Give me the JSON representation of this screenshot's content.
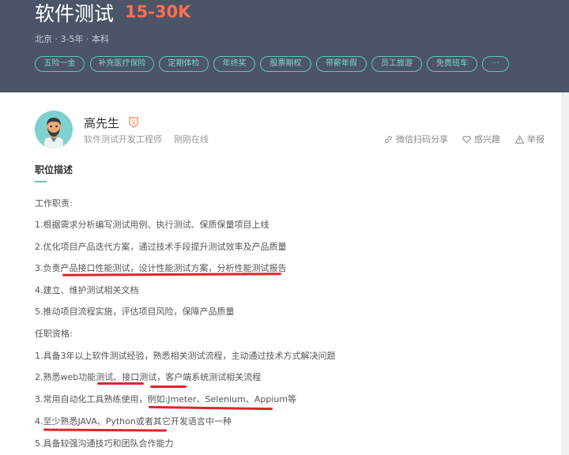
{
  "job": {
    "title": "软件测试",
    "salary": "15-30K",
    "meta": "北京 · 3-5年 · 本科"
  },
  "tags": [
    "五险一金",
    "补充医疗保险",
    "定期体检",
    "年终奖",
    "股票期权",
    "带薪年假",
    "员工旅游",
    "免费班车",
    "···"
  ],
  "recruiter": {
    "name": "高先生",
    "badge": "V",
    "role": "软件测试开发工程师",
    "status": "刚刚在线"
  },
  "actions": {
    "share": "微信扫码分享",
    "interest": "感兴趣",
    "report": "举报"
  },
  "description": {
    "section_title": "职位描述",
    "lines": [
      "工作职责:",
      "1.根据需求分析编写测试用例、执行测试、保质保量项目上线",
      "2.优化项目产品迭代方案，通过技术手段提升测试效率及产品质量",
      "3.负责产品接口性能测试，设计性能测试方案，分析性能测试报告",
      "4.建立、维护测试相关文档",
      "5.推动项目流程实施，评估项目风险，保障产品质量",
      "任职资格:",
      "1.具备3年以上软件测试经验，熟悉相关测试流程，主动通过技术方式解决问题",
      "2.熟悉web功能测试、接口测试，客户端系统测试相关流程",
      "3.常用自动化工具熟练使用，例如:Jmeter、Selenium、Appium等",
      "4.至少熟悉JAVA、Python或者其它开发语言中一种",
      "5.具备较强沟通技巧和团队合作能力"
    ]
  },
  "colors": {
    "header_bg": "#4b5567",
    "salary": "#ff6f4e",
    "accent": "#5fc6b6",
    "highlight_mark": "#e0232b"
  },
  "icons": [
    "verified-badge-icon",
    "link-icon",
    "heart-icon",
    "warning-icon",
    "avatar-icon"
  ]
}
